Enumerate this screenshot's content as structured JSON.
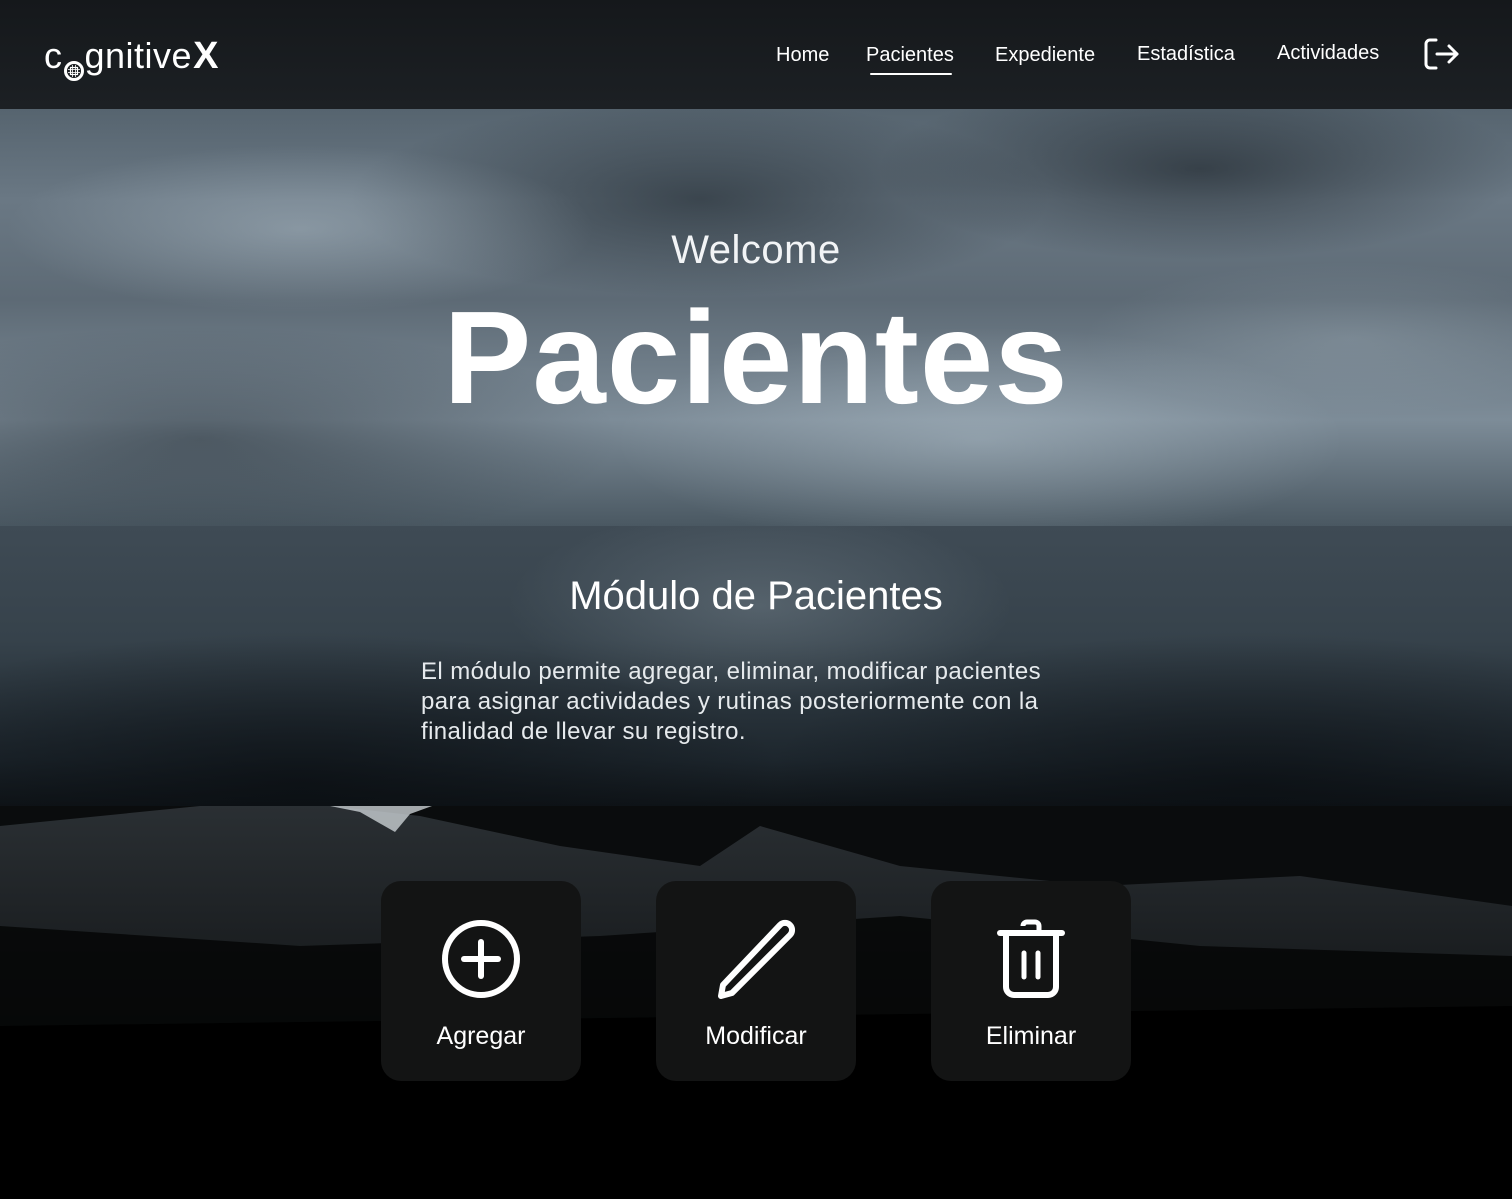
{
  "brand": {
    "logo_prefix": "c",
    "logo_rest": "gnitive",
    "logo_x": "X"
  },
  "nav": {
    "items": [
      {
        "label": "Home",
        "active": false
      },
      {
        "label": "Pacientes",
        "active": true
      },
      {
        "label": "Expediente",
        "active": false
      },
      {
        "label": "Estadística",
        "active": false
      },
      {
        "label": "Actividades",
        "active": false
      }
    ],
    "logout_icon": "logout-icon"
  },
  "hero": {
    "welcome": "Welcome",
    "title": "Pacientes"
  },
  "module": {
    "title": "Módulo de Pacientes",
    "description": "El módulo permite agregar, eliminar, modificar pacientes para asignar actividades y rutinas posteriormente con la finalidad de llevar su registro."
  },
  "actions": [
    {
      "label": "Agregar",
      "icon": "plus-circle-icon"
    },
    {
      "label": "Modificar",
      "icon": "pencil-icon"
    },
    {
      "label": "Eliminar",
      "icon": "trash-icon"
    }
  ],
  "colors": {
    "header_bg": "#1a1e22",
    "card_bg": "#131414",
    "text": "#ffffff"
  }
}
